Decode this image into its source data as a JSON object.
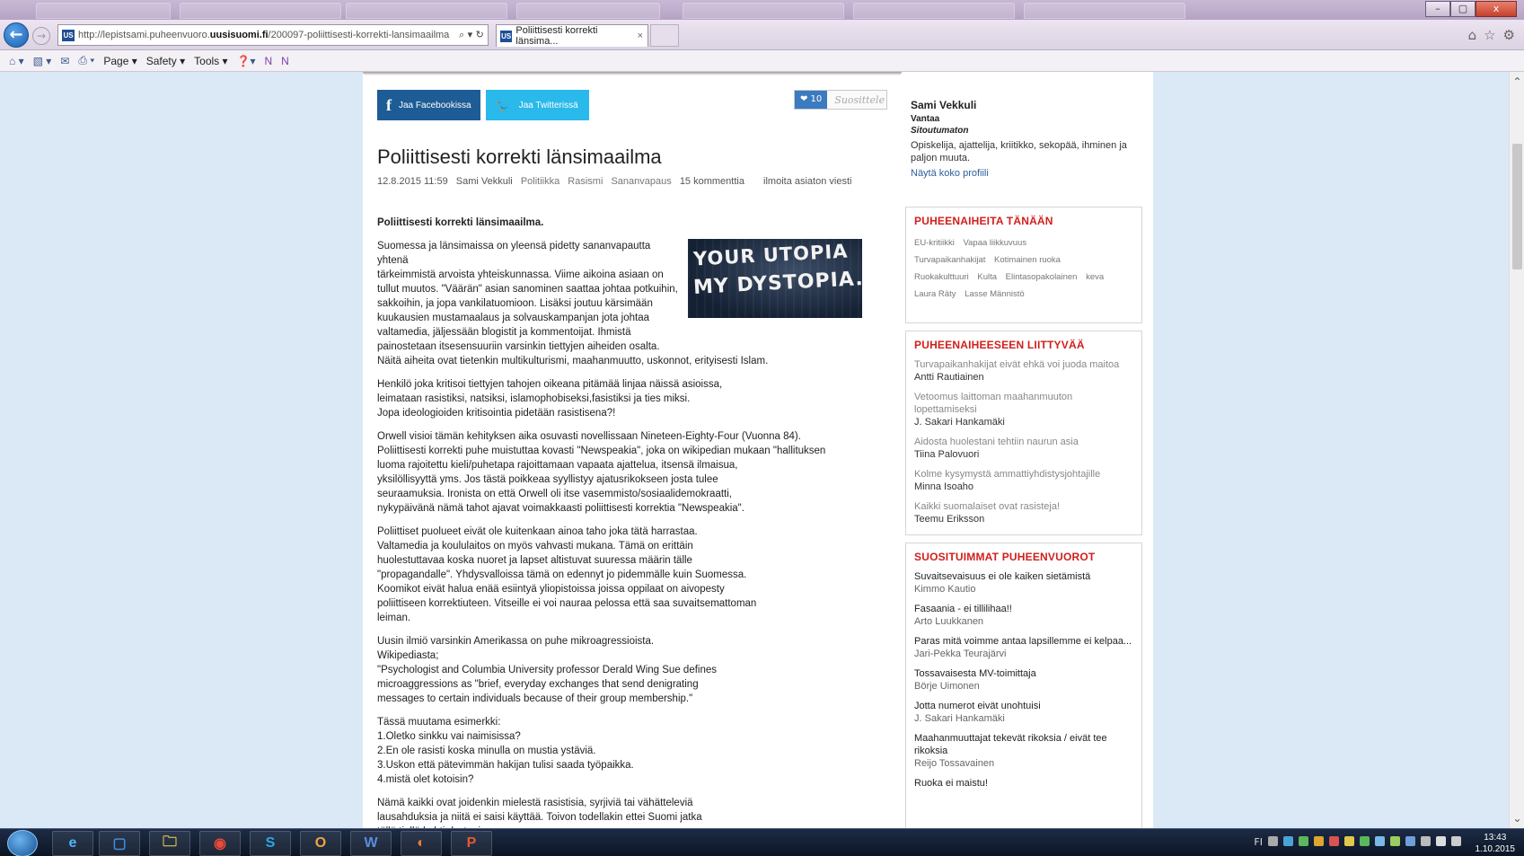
{
  "browser": {
    "url_prefix": "http://lepistsami.puheenvuoro.",
    "url_domain": "uusisuomi.fi",
    "url_path": "/200097-poliittisesti-korrekti-lansimaailma",
    "address_controls": "⌕ ▾ ↻",
    "site_badge": "US",
    "tab_title": "Poliittisesti korrekti länsima...",
    "tab_close": "×",
    "back_glyph": "←",
    "forward_glyph": "→",
    "window_buttons": {
      "minimize": "–",
      "maximize": "▢",
      "close": "x"
    },
    "right_icons": [
      "home-icon",
      "favorites-star-icon",
      "settings-gear-icon"
    ]
  },
  "command_bar": {
    "items": [
      "Page ▾",
      "Safety ▾",
      "Tools ▾"
    ]
  },
  "share": {
    "facebook_label": "Jaa Facebookissa",
    "twitter_label": "Jaa Twitterissä",
    "facebook_glyph": "f",
    "twitter_glyph": "🐦"
  },
  "recommend": {
    "count": "❤ 10",
    "label": "Suosittele"
  },
  "article": {
    "title": "Poliittisesti korrekti länsimaailma",
    "date": "12.8.2015 11:59",
    "author": "Sami Vekkuli",
    "categories": [
      "Politiikka",
      "Rasismi",
      "Sananvapaus"
    ],
    "comments": "15 kommenttia",
    "report": "ilmoita asiaton viesti",
    "lead": "Poliittisesti korrekti länsimaailma.",
    "image_text": [
      "YOUR UTOPIA",
      "MY DYSTOPIA."
    ],
    "paragraphs": [
      "Suomessa ja länsimaissa on yleensä pidetty sananvapautta yhtenä\ntärkeimmistä arvoista yhteiskunnassa. Viime aikoina asiaan on\ntullut muutos. \"Väärän\" asian sanominen saattaa johtaa potkuihin,\nsakkoihin, ja jopa vankilatuomioon. Lisäksi joutuu kärsimään\nkuukausien mustamaalaus ja solvauskampanjan jota johtaa\nvaltamedia, jäljessään blogistit ja kommentoijat. Ihmistä\npainostetaan itsesensuuriin varsinkin tiettyjen aiheiden osalta.\nNäitä aiheita ovat tietenkin multikulturismi, maahanmuutto, uskonnot, erityisesti Islam.",
      "Henkilö joka kritisoi tiettyjen tahojen oikeana pitämää linjaa näissä asioissa,\nleimataan rasistiksi, natsiksi, islamophobiseksi,fasistiksi ja ties miksi.\nJopa ideologioiden kritisointia pidetään rasistisena?!",
      "Orwell visioi tämän kehityksen aika osuvasti novellissaan Nineteen-Eighty-Four (Vuonna 84).\nPoliittisesti korrekti puhe muistuttaa kovasti \"Newspeakia\", joka on wikipedian mukaan \"hallituksen\nluoma rajoitettu kieli/puhetapa rajoittamaan vapaata ajattelua, itsensä ilmaisua,\nyksilöllisyyttä yms. Jos tästä poikkeaa syyllistyy ajatusrikokseen josta tulee\nseuraamuksia. Ironista on että Orwell oli itse vasemmisto/sosiaalidemokraatti,\nnykypäivänä nämä tahot ajavat voimakkaasti poliittisesti korrektia \"Newspeakia\".",
      "Poliittiset puolueet eivät ole kuitenkaan ainoa taho joka tätä harrastaa.\nValtamedia ja koululaitos on myös vahvasti mukana. Tämä on erittäin\nhuolestuttavaa koska nuoret ja lapset altistuvat suuressa määrin tälle\n\"propagandalle\". Yhdysvalloissa tämä on edennyt jo pidemmälle kuin Suomessa.\nKoomikot eivät halua enää esiintyä yliopistoissa joissa oppilaat on aivopesty\npoliittiseen korrektiuteen. Vitseille ei voi nauraa pelossa että saa suvaitsemattoman\nleiman.",
      "Uusin ilmiö varsinkin Amerikassa on puhe mikroagressioista.\nWikipediasta;\n\"Psychologist and Columbia University professor Derald Wing Sue defines\nmicroaggressions as \"brief, everyday exchanges that send denigrating\nmessages to certain individuals because of their group membership.\"",
      "Tässä muutama esimerkki:\n1.Oletko sinkku vai naimisissa?\n2.En ole rasisti koska minulla on mustia ystäviä.\n3.Uskon että pätevimmän hakijan tulisi saada työpaikka.\n4.mistä olet kotoisin?",
      "Nämä kaikki ovat joidenkin mielestä rasistisia, syrjiviä tai vähätteleviä\nlausahduksia ja niitä ei saisi käyttää. Toivon todellakin ettei Suomi jatka\ntällä tiellä kohti dystopiaa."
    ]
  },
  "author_box": {
    "name": "Sami Vekkuli",
    "city": "Vantaa",
    "party": "Sitoutumaton",
    "description": "Opiskelija, ajattelija, kriitikko, sekopää, ihminen ja paljon muuta.",
    "profile_link": "Näytä koko profiili"
  },
  "topics_today": {
    "title": "PUHEENAIHEITA TÄNÄÄN",
    "tags": [
      "EU-kritiikki",
      "Vapaa liikkuvuus",
      "Turvapaikanhakijat",
      "Kotimainen ruoka",
      "Ruokakulttuuri",
      "Kulta",
      "Elintasopakolainen",
      "keva",
      "Laura Räty",
      "Lasse Männistö"
    ]
  },
  "related": {
    "title": "PUHEENAIHEESEEN LIITTYVÄÄ",
    "items": [
      {
        "title": "Turvapaikanhakijat eivät ehkä voi juoda maitoa",
        "author": "Antti Rautiainen"
      },
      {
        "title": "Vetoomus laittoman maahanmuuton lopettamiseksi",
        "author": "J. Sakari Hankamäki"
      },
      {
        "title": "Aidosta huolestani tehtiin naurun asia",
        "author": "Tiina Palovuori"
      },
      {
        "title": "Kolme kysymystä ammattiyhdistysjohtajille",
        "author": "Minna Isoaho"
      },
      {
        "title": "Kaikki suomalaiset ovat rasisteja!",
        "author": "Teemu Eriksson"
      }
    ]
  },
  "popular": {
    "title": "SUOSITUIMMAT PUHEENVUOROT",
    "items": [
      {
        "title": "Suvaitsevaisuus ei ole kaiken sietämistä",
        "author": "Kimmo Kautio"
      },
      {
        "title": "Fasaania - ei tillilihaa!!",
        "author": "Arto Luukkanen"
      },
      {
        "title": "Paras mitä voimme antaa lapsillemme ei kelpaa...",
        "author": "Jari-Pekka Teurajärvi"
      },
      {
        "title": "Tossavaisesta MV-toimittaja",
        "author": "Börje Uimonen"
      },
      {
        "title": "Jotta numerot eivät unohtuisi",
        "author": "J. Sakari Hankamäki"
      },
      {
        "title": "Maahanmuuttajat tekevät rikoksia / eivät tee rikoksia",
        "author": "Reijo Tossavainen"
      },
      {
        "title": "Ruoka ei maistu!",
        "author": ""
      }
    ]
  },
  "taskbar": {
    "apps": [
      "e",
      "▢",
      "🗀",
      "◉",
      "S",
      "O",
      "W",
      "◐",
      "P"
    ],
    "tray_lang": "FI",
    "time": "13:43",
    "date": "1.10.2015"
  }
}
